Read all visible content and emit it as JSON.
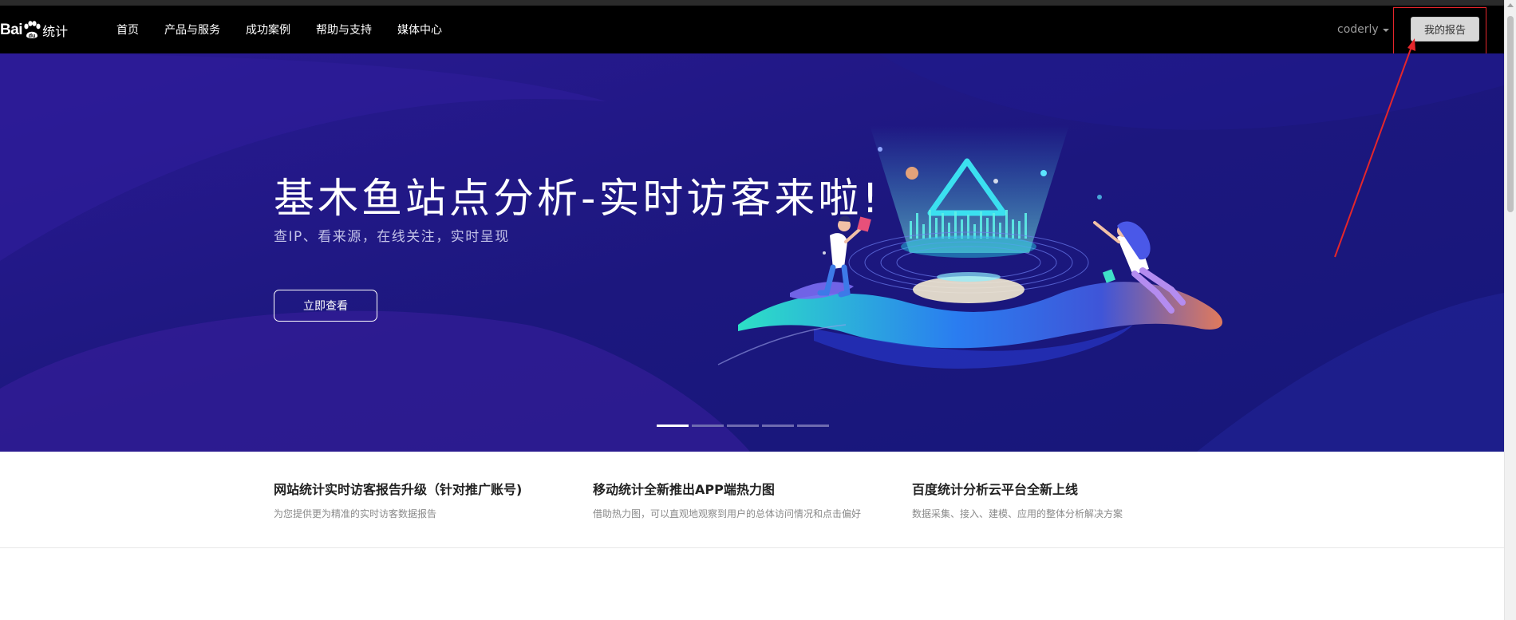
{
  "brand": {
    "logo_text_1": "Bai",
    "logo_text_2": "du",
    "logo_sub": "统计"
  },
  "nav": {
    "items": [
      {
        "label": "首页"
      },
      {
        "label": "产品与服务"
      },
      {
        "label": "成功案例"
      },
      {
        "label": "帮助与支持"
      },
      {
        "label": "媒体中心"
      }
    ],
    "username": "coderly",
    "report_label": "我的报告"
  },
  "hero": {
    "title": "基木鱼站点分析-实时访客来啦!",
    "subtitle": "查IP、看来源，在线关注，实时呈现",
    "button_label": "立即查看",
    "slides": 5,
    "active_slide": 1
  },
  "news": [
    {
      "title": "网站统计实时访客报告升级（针对推广账号)",
      "desc": "为您提供更为精准的实时访客数据报告"
    },
    {
      "title": "移动统计全新推出APP端热力图",
      "desc": "借助热力图，可以直观地观察到用户的总体访问情况和点击偏好"
    },
    {
      "title": "百度统计分析云平台全新上线",
      "desc": "数据采集、接入、建模、应用的整体分析解决方案"
    }
  ],
  "colors": {
    "navbar": "#000000",
    "hero_bg": "#1b1780",
    "annotation": "#e5262b",
    "report_button": "#d8d8d8"
  }
}
